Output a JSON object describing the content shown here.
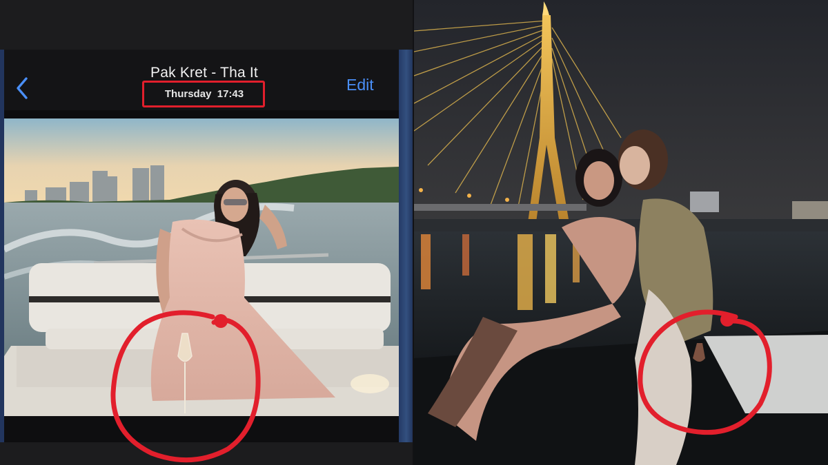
{
  "album_header": {
    "title": "Pak Kret - Tha It",
    "timestamp": "Thursday  17:43",
    "edit_label": "Edit",
    "back_icon": "chevron-left-icon"
  },
  "colors": {
    "accent_blue": "#4a8ff7",
    "highlight_red": "#e21f2c",
    "bridge_gold": "#e0a83a"
  },
  "annotations": [
    {
      "type": "red-box",
      "target": "timestamp"
    },
    {
      "type": "red-circle",
      "target": "champagne-glass"
    },
    {
      "type": "red-circle",
      "target": "champagne-glass-night"
    }
  ]
}
